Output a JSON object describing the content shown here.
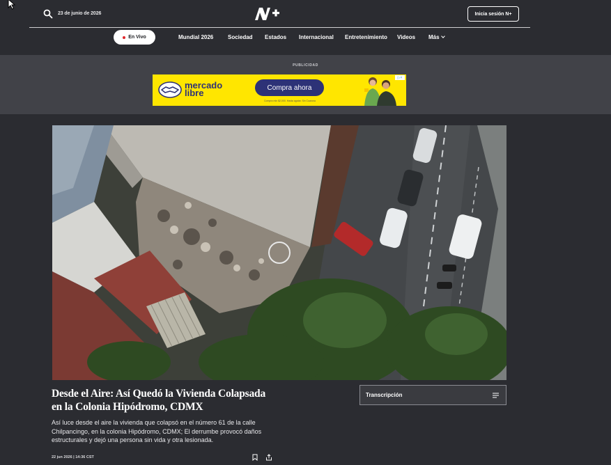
{
  "header": {
    "date": "23 de junio de 2026",
    "login_label": "Inicia sesión N+"
  },
  "nav": {
    "live_label": "En Vivo",
    "items": [
      "Mundial 2026",
      "Sociedad",
      "Estados",
      "Internacional",
      "Entretenimiento",
      "Videos",
      "Más"
    ]
  },
  "ad": {
    "label": "PUBLICIDAD",
    "brand_line1": "mercado",
    "brand_line2": "libre",
    "cta": "Compra ahora",
    "fine_print": "Compra min $2,000. Hasta agotar. Sin Cuarona",
    "accent": "#ffe600",
    "brand_color": "#2d3277"
  },
  "article": {
    "headline": "Desde el Aire: Así Quedó la Vivienda Colapsada en la Colonia Hipódromo, CDMX",
    "summary": "Así luce desde el aire la vivienda que colapsó en el número 61 de la calle Chilpancingo, en la colonia Hipódromo, CDMX; El derrumbe provocó daños estructurales y dejó una persona sin vida y otra lesionada.",
    "meta": "22 jun 2026 | 14:36 CST",
    "transcript_label": "Transcripción"
  },
  "icons": {
    "search": "search-icon",
    "bookmark": "bookmark-icon",
    "share": "share-icon",
    "transcript": "lines-icon"
  }
}
